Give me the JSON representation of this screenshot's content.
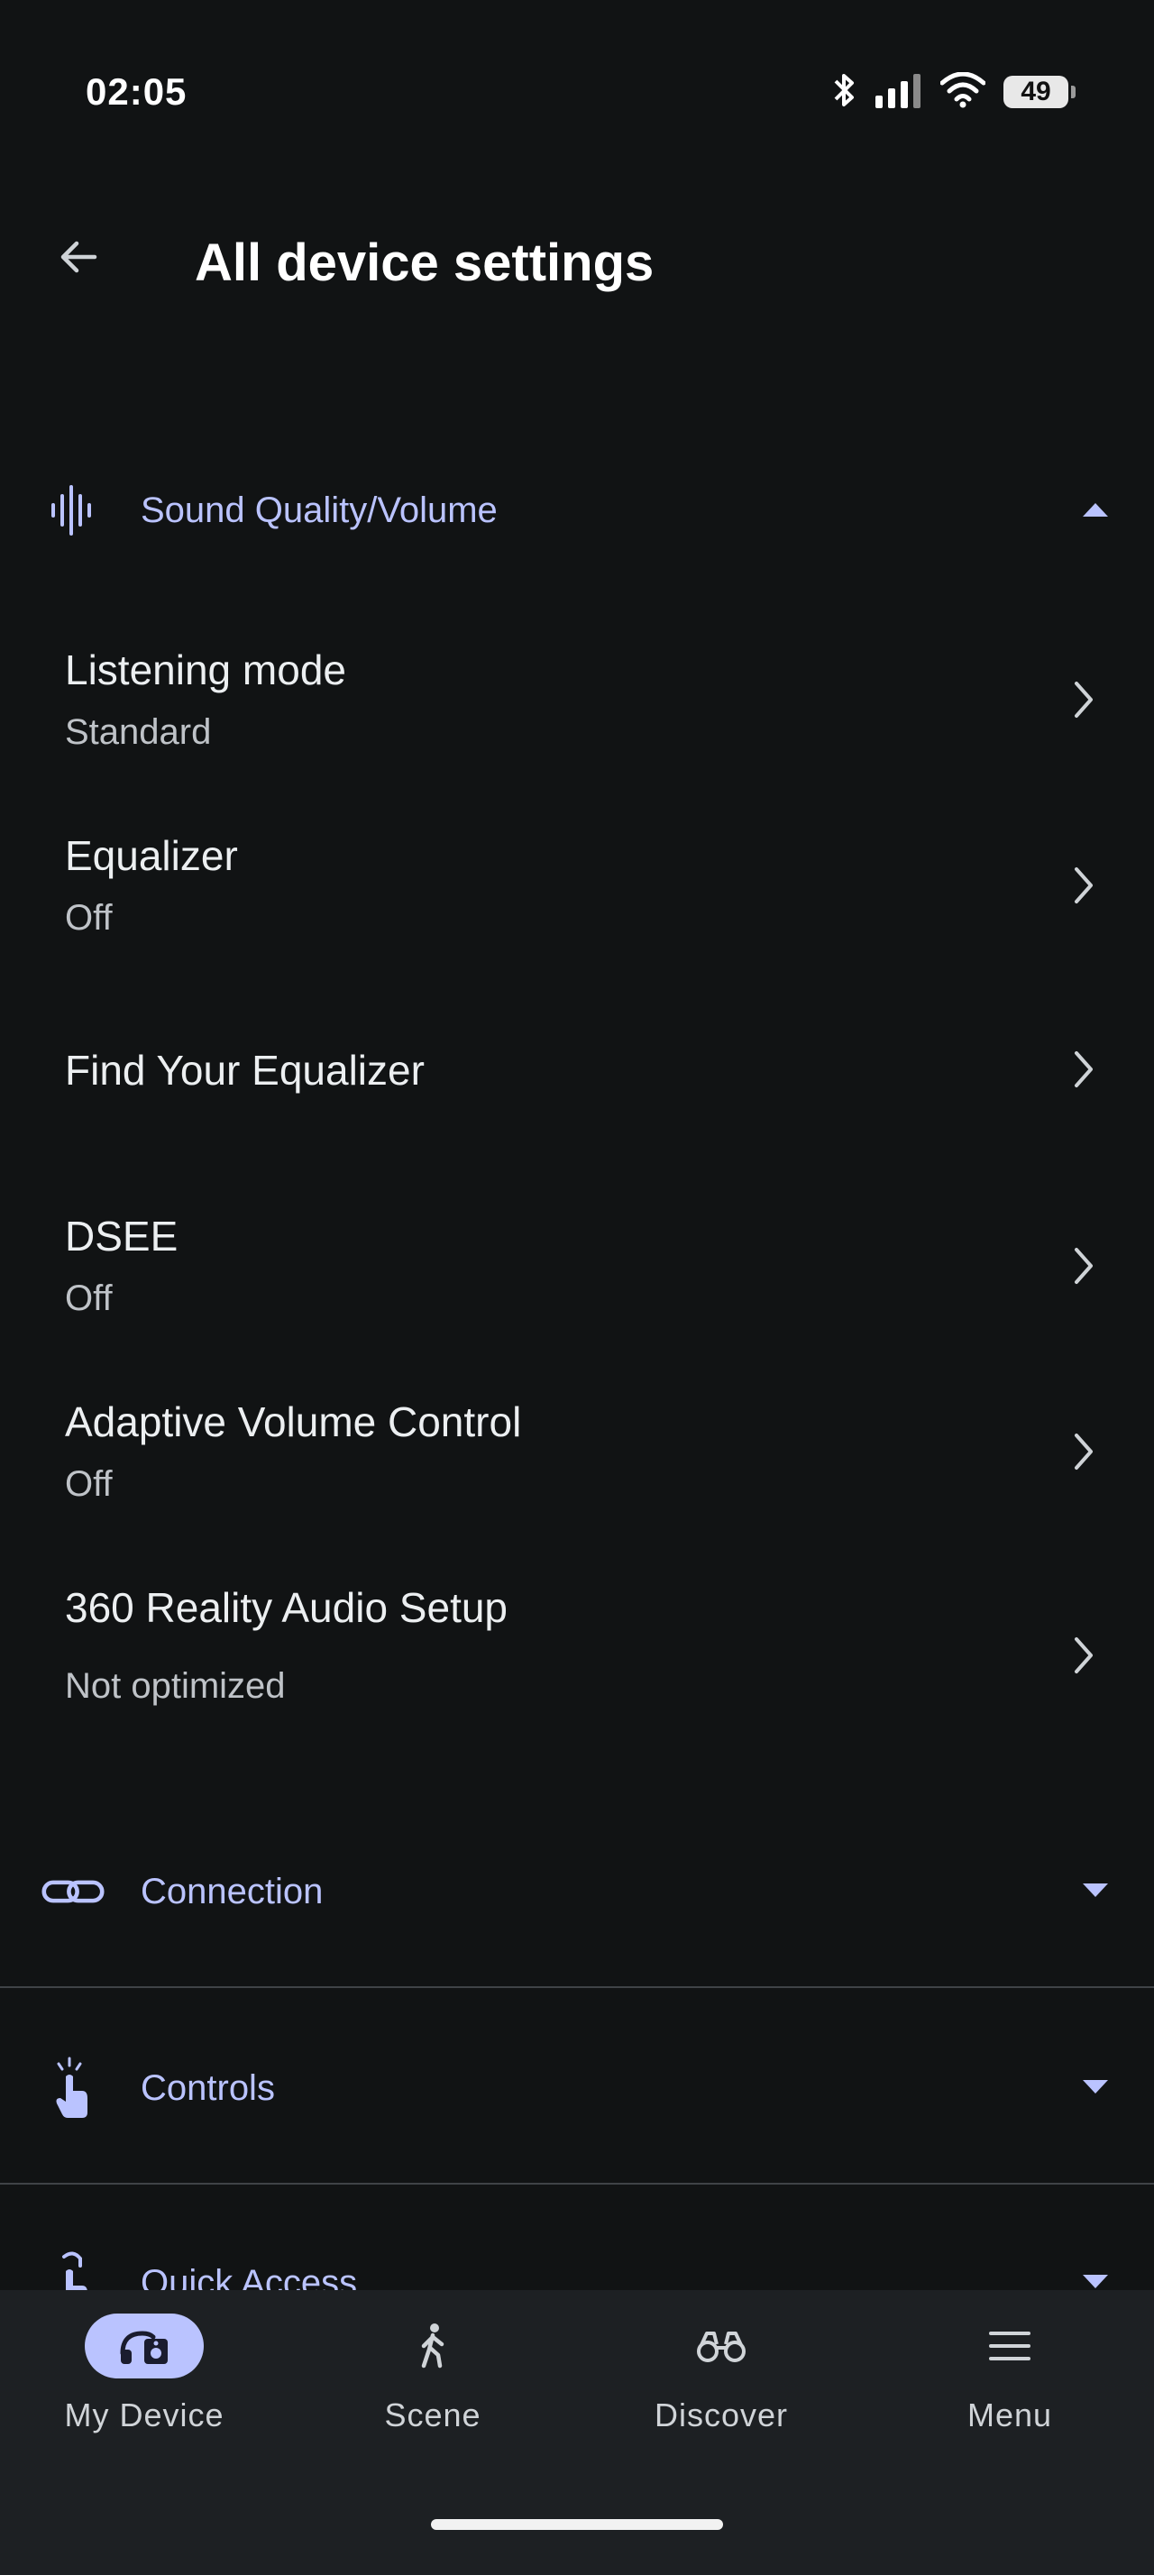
{
  "status": {
    "time": "02:05",
    "battery": "49"
  },
  "header": {
    "title": "All device settings"
  },
  "sections": {
    "sound": {
      "label": "Sound Quality/Volume"
    },
    "connection": {
      "label": "Connection"
    },
    "controls": {
      "label": "Controls"
    },
    "quick_access": {
      "label": "Quick Access"
    }
  },
  "settings": [
    {
      "title": "Listening mode",
      "value": "Standard"
    },
    {
      "title": "Equalizer",
      "value": "Off"
    },
    {
      "title": "Find Your Equalizer"
    },
    {
      "title": "DSEE",
      "value": "Off"
    },
    {
      "title": "Adaptive Volume Control",
      "value": "Off"
    },
    {
      "title": "360 Reality Audio Setup",
      "value": "Not optimized"
    }
  ],
  "nav": [
    {
      "label": "My Device",
      "icon": "headphones-icon",
      "active": true
    },
    {
      "label": "Scene",
      "icon": "walking-person-icon"
    },
    {
      "label": "Discover",
      "icon": "binoculars-icon"
    },
    {
      "label": "Menu",
      "icon": "hamburger-menu-icon"
    }
  ],
  "colors": {
    "accent": "#bac3ff",
    "background": "#111314",
    "nav_background": "#1d2023"
  }
}
